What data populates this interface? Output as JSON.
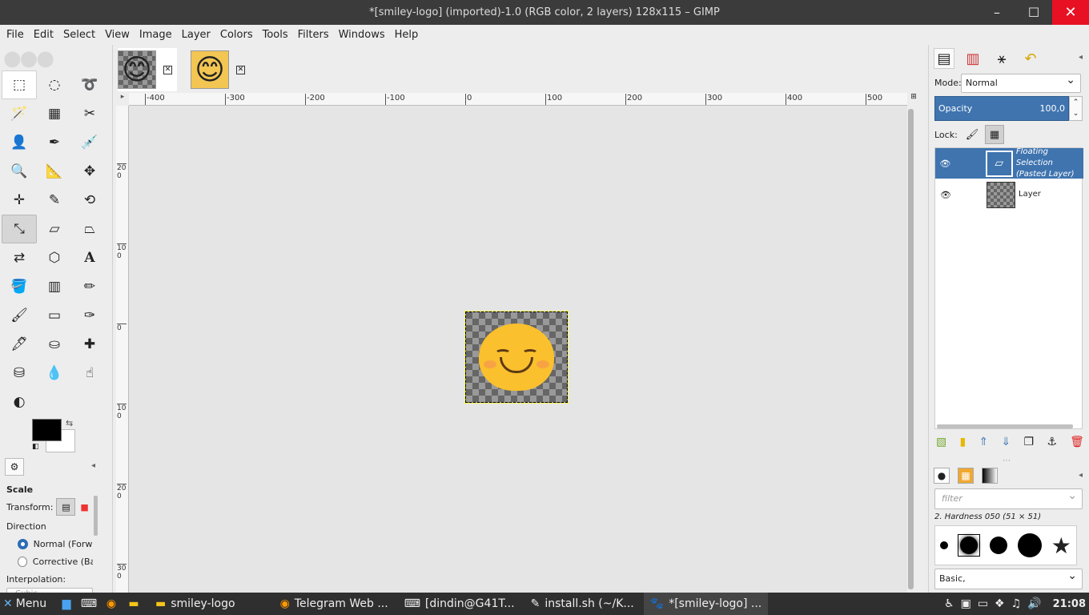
{
  "window": {
    "title": "*[smiley-logo] (imported)-1.0 (RGB color, 2 layers) 128x115 – GIMP",
    "min": "–",
    "max": "☐",
    "close": "✕"
  },
  "menu": [
    "File",
    "Edit",
    "Select",
    "View",
    "Image",
    "Layer",
    "Colors",
    "Tools",
    "Filters",
    "Windows",
    "Help"
  ],
  "toolbox": {
    "tools": [
      "rect-select",
      "ellipse-select",
      "free-select",
      "fuzzy-select",
      "select-by-color",
      "scissors-select",
      "foreground-select",
      "paths",
      "color-picker",
      "zoom",
      "measure",
      "move",
      "alignment",
      "crop",
      "unified-transform",
      "scale",
      "shear",
      "perspective",
      "flip",
      "cage-transform",
      "text",
      "bucket-fill",
      "gradient",
      "pencil",
      "paintbrush",
      "eraser",
      "airbrush",
      "ink",
      "clone",
      "heal",
      "perspective-clone",
      "blur",
      "smudge",
      "dodge-burn"
    ],
    "tool_options": {
      "title": "Scale",
      "transform_label": "Transform:",
      "direction_label": "Direction",
      "direction_normal": "Normal (Forwa",
      "direction_corrective": "Corrective (Bac",
      "interpolation_label": "Interpolation:",
      "interpolation_value": "Cubic"
    }
  },
  "image_tabs": [
    {
      "name": "smiley-logo (imported)",
      "active": true
    },
    {
      "name": "smiley-logo",
      "active": false
    }
  ],
  "ruler": {
    "top": [
      "-400",
      "-300",
      "-200",
      "-100",
      "0",
      "100",
      "200",
      "300",
      "400",
      "500"
    ],
    "left": [
      "200",
      "100",
      "0",
      "100",
      "200",
      "300"
    ]
  },
  "dock": {
    "mode_label": "Mode:",
    "mode_value": "Normal",
    "opacity_label": "Opacity",
    "opacity_value": "100,0",
    "lock_label": "Lock:",
    "layers": [
      {
        "name_line1": "Floating Selection",
        "name_line2": "(Pasted Layer)",
        "selected": true,
        "visible": true
      },
      {
        "name_line1": "Layer",
        "name_line2": "",
        "selected": false,
        "visible": true
      }
    ],
    "brush_filter_placeholder": "filter",
    "brush_name": "2. Hardness 050 (51 × 51)",
    "brush_set": "Basic,"
  },
  "taskbar": {
    "start_label": "Menu",
    "tasks": [
      {
        "label": "smiley-logo",
        "icon": "folder-icon",
        "active": false
      },
      {
        "label": "Telegram Web ...",
        "icon": "browser-icon",
        "active": false
      },
      {
        "label": "[dindin@G41T...",
        "icon": "terminal-icon",
        "active": false
      },
      {
        "label": "install.sh (~/K...",
        "icon": "editor-icon",
        "active": false
      },
      {
        "label": "*[smiley-logo] ...",
        "icon": "gimp-icon",
        "active": true
      }
    ],
    "clock": "21:08"
  }
}
